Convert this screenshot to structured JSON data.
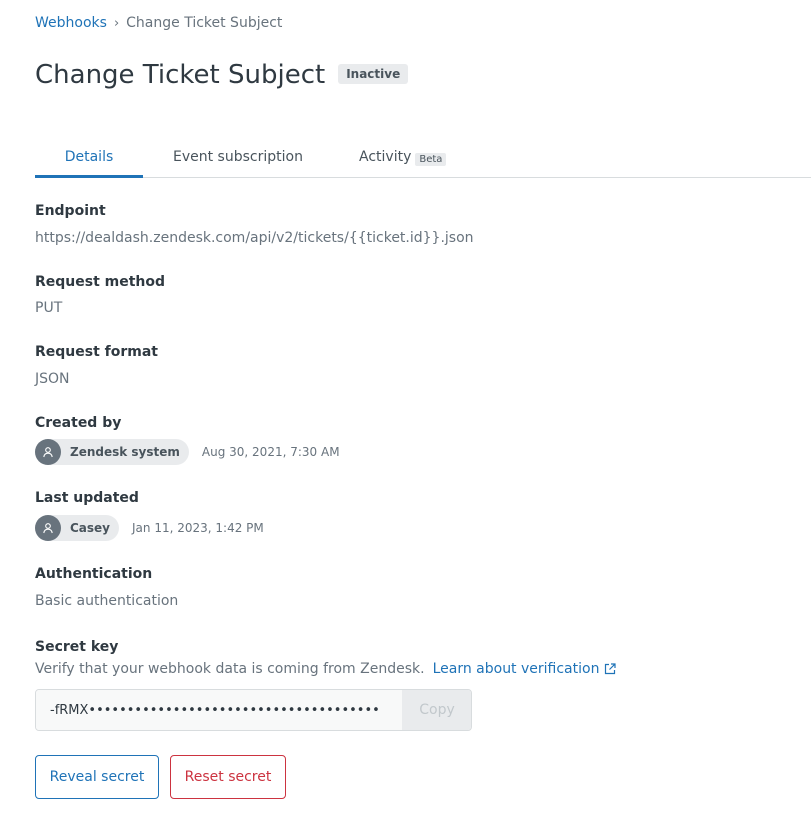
{
  "breadcrumb": {
    "parent": "Webhooks",
    "separator": "›",
    "current": "Change Ticket Subject"
  },
  "header": {
    "title": "Change Ticket Subject",
    "status": "Inactive"
  },
  "tabs": [
    {
      "label": "Details",
      "active": true
    },
    {
      "label": "Event subscription",
      "active": false
    },
    {
      "label": "Activity",
      "badge": "Beta",
      "active": false
    }
  ],
  "details": {
    "endpoint": {
      "label": "Endpoint",
      "value": "https://dealdash.zendesk.com/api/v2/tickets/{{ticket.id}}.json"
    },
    "request_method": {
      "label": "Request method",
      "value": "PUT"
    },
    "request_format": {
      "label": "Request format",
      "value": "JSON"
    },
    "created_by": {
      "label": "Created by",
      "name": "Zendesk system",
      "date": "Aug 30, 2021, 7:30 AM"
    },
    "last_updated": {
      "label": "Last updated",
      "name": "Casey",
      "date": "Jan 11, 2023, 1:42 PM"
    },
    "authentication": {
      "label": "Authentication",
      "value": "Basic authentication"
    },
    "secret_key": {
      "label": "Secret key",
      "help": "Verify that your webhook data is coming from Zendesk.",
      "link": "Learn about verification",
      "value": "-fRMX••••••••••••••••••••••••••••••••••••••",
      "copy_label": "Copy"
    }
  },
  "actions": {
    "reveal": "Reveal secret",
    "reset": "Reset secret"
  },
  "colors": {
    "link": "#1f73b7",
    "danger": "#cc3340",
    "text": "#2f3941",
    "muted": "#68737d"
  }
}
